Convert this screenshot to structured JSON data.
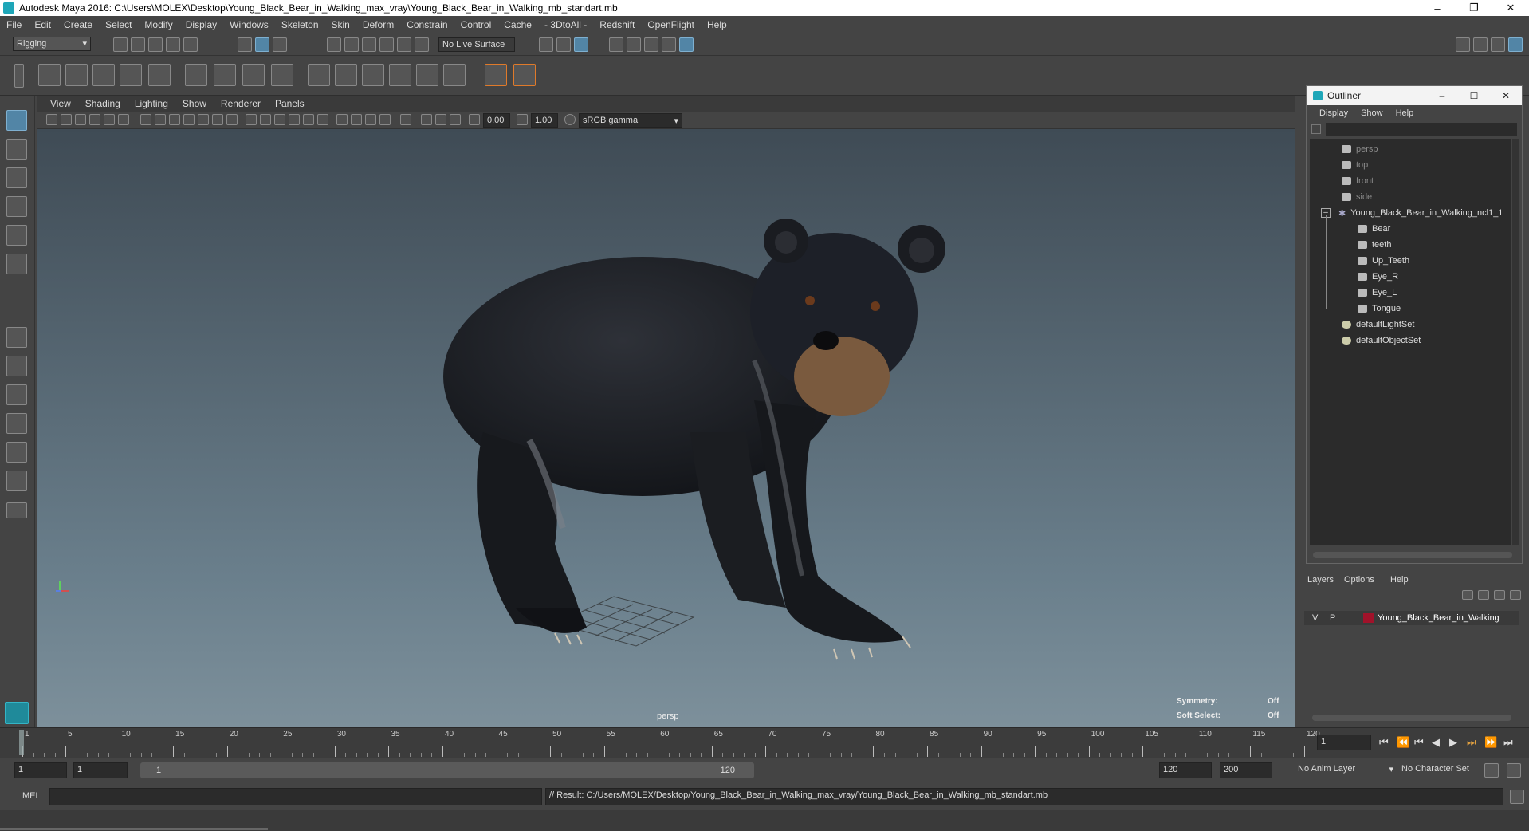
{
  "window": {
    "title": "Autodesk Maya 2016: C:\\Users\\MOLEX\\Desktop\\Young_Black_Bear_in_Walking_max_vray\\Young_Black_Bear_in_Walking_mb_standart.mb"
  },
  "menubar": [
    "File",
    "Edit",
    "Create",
    "Select",
    "Modify",
    "Display",
    "Windows",
    "Skeleton",
    "Skin",
    "Deform",
    "Constrain",
    "Control",
    "Cache",
    "- 3DtoAll -",
    "Redshift",
    "OpenFlight",
    "Help"
  ],
  "toolbar": {
    "mode": "Rigging",
    "live_surface": "No Live Surface"
  },
  "viewport": {
    "menu": [
      "View",
      "Shading",
      "Lighting",
      "Show",
      "Renderer",
      "Panels"
    ],
    "exposure": "0.00",
    "gamma": "1.00",
    "color_space": "sRGB gamma",
    "camera_label": "persp",
    "symmetry_label": "Symmetry:",
    "symmetry_value": "Off",
    "soft_select_label": "Soft Select:",
    "soft_select_value": "Off"
  },
  "outliner": {
    "title": "Outliner",
    "menu": [
      "Display",
      "Show",
      "Help"
    ],
    "items": [
      {
        "label": "persp",
        "dim": true
      },
      {
        "label": "top",
        "dim": true
      },
      {
        "label": "front",
        "dim": true
      },
      {
        "label": "side",
        "dim": true
      },
      {
        "label": "Young_Black_Bear_in_Walking_ncl1_1",
        "dim": false
      },
      {
        "label": "Bear",
        "dim": false
      },
      {
        "label": "teeth",
        "dim": false
      },
      {
        "label": "Up_Teeth",
        "dim": false
      },
      {
        "label": "Eye_R",
        "dim": false
      },
      {
        "label": "Eye_L",
        "dim": false
      },
      {
        "label": "Tongue",
        "dim": false
      },
      {
        "label": "defaultLightSet",
        "dim": false
      },
      {
        "label": "defaultObjectSet",
        "dim": false
      }
    ]
  },
  "layers": {
    "menu": [
      "Layers",
      "Options",
      "Help"
    ],
    "row": {
      "v": "V",
      "p": "P",
      "name": "Young_Black_Bear_in_Walking",
      "color": "#a0122a"
    }
  },
  "timeline": {
    "ticks": [
      "1",
      "5",
      "10",
      "15",
      "20",
      "25",
      "30",
      "35",
      "40",
      "45",
      "50",
      "55",
      "60",
      "65",
      "70",
      "75",
      "80",
      "85",
      "90",
      "95",
      "100",
      "105",
      "110",
      "115",
      "120"
    ],
    "current_frame": "1"
  },
  "range": {
    "start": "1",
    "start2": "1",
    "slider_start": "1",
    "slider_end": "120",
    "end": "120",
    "end2": "200",
    "anim_layer": "No Anim Layer",
    "char_set": "No Character Set"
  },
  "command": {
    "lang": "MEL",
    "result": "// Result: C:/Users/MOLEX/Desktop/Young_Black_Bear_in_Walking_max_vray/Young_Black_Bear_in_Walking_mb_standart.mb"
  },
  "colors": {
    "accent": "#5285a6",
    "bear": "#1c1e22"
  }
}
